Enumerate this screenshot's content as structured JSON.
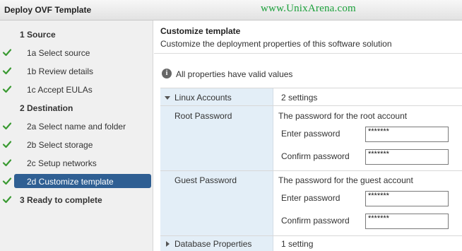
{
  "window": {
    "title": "Deploy OVF Template",
    "watermark": "www.UnixArena.com"
  },
  "sidebar": {
    "steps": [
      {
        "label": "1  Source",
        "type": "section",
        "checked": false
      },
      {
        "label": "1a  Select source",
        "type": "item",
        "checked": true
      },
      {
        "label": "1b  Review details",
        "type": "item",
        "checked": true
      },
      {
        "label": "1c  Accept EULAs",
        "type": "item",
        "checked": true
      },
      {
        "label": "2  Destination",
        "type": "section",
        "checked": false
      },
      {
        "label": "2a  Select name and folder",
        "type": "item",
        "checked": true
      },
      {
        "label": "2b  Select storage",
        "type": "item",
        "checked": true
      },
      {
        "label": "2c  Setup networks",
        "type": "item",
        "checked": true
      },
      {
        "label": "2d  Customize template",
        "type": "item",
        "checked": true,
        "active": true
      },
      {
        "label": "3  Ready to complete",
        "type": "section",
        "checked": true
      }
    ]
  },
  "main": {
    "heading": "Customize template",
    "subheading": "Customize the deployment properties of this software solution",
    "info": "All properties have valid values",
    "groups": {
      "linux": {
        "label": "Linux Accounts",
        "summary": "2 settings",
        "expanded": true
      },
      "database": {
        "label": "Database Properties",
        "summary": "1 setting",
        "expanded": false
      }
    },
    "root": {
      "label": "Root Password",
      "description": "The  password for the root account",
      "enter_label": "Enter password",
      "enter_value": "*******",
      "confirm_label": "Confirm password",
      "confirm_value": "*******"
    },
    "guest": {
      "label": "Guest Password",
      "description": "The password for the guest account",
      "enter_label": "Enter password",
      "enter_value": "*******",
      "confirm_label": "Confirm password",
      "confirm_value": "*******"
    }
  },
  "colors": {
    "check": "#3a9a32",
    "active_bg": "#2f5f93",
    "watermark": "#1aa03a",
    "key_column_bg": "#e3eef7"
  }
}
